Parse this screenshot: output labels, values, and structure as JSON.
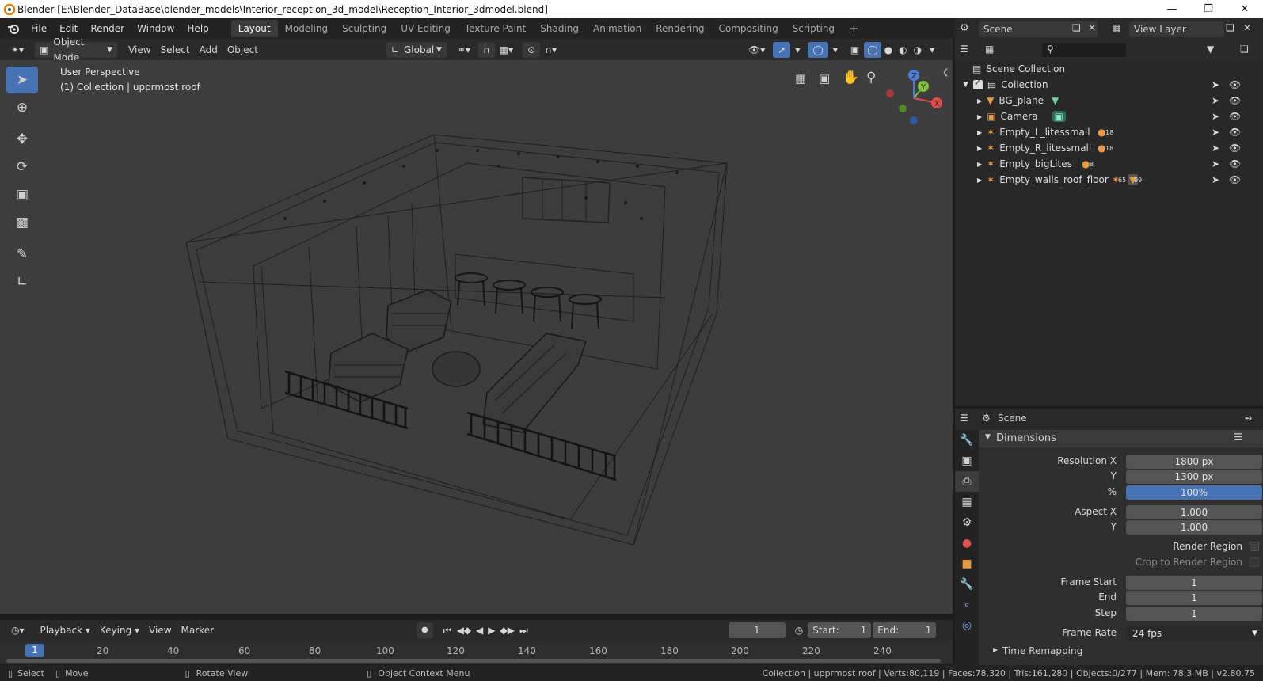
{
  "window": {
    "title": "Blender [E:\\Blender_DataBase\\blender_models\\Interior_reception_3d_model\\Reception_Interior_3dmodel.blend]"
  },
  "menus": [
    "File",
    "Edit",
    "Render",
    "Window",
    "Help"
  ],
  "workspaces": [
    "Layout",
    "Modeling",
    "Sculpting",
    "UV Editing",
    "Texture Paint",
    "Shading",
    "Animation",
    "Rendering",
    "Compositing",
    "Scripting"
  ],
  "active_workspace": "Layout",
  "scene": {
    "name": "Scene",
    "view_layer": "View Layer"
  },
  "viewport_header": {
    "mode": "Object Mode",
    "menu": [
      "View",
      "Select",
      "Add",
      "Object"
    ],
    "orientation": "Global"
  },
  "viewport": {
    "perspective": "User Perspective",
    "collection_info": "(1) Collection | upprmost roof",
    "axes": {
      "x": "X",
      "y": "Y",
      "z": "Z"
    }
  },
  "outliner": {
    "root": "Scene Collection",
    "collection": "Collection",
    "items": [
      {
        "name": "BG_plane",
        "badge": ""
      },
      {
        "name": "Camera",
        "badge": ""
      },
      {
        "name": "Empty_L_litessmall",
        "badge": "18"
      },
      {
        "name": "Empty_R_litessmall",
        "badge": "18"
      },
      {
        "name": "Empty_bigLites",
        "badge": "8"
      },
      {
        "name": "Empty_walls_roof_floor",
        "badge": "65",
        "badge2": "99"
      }
    ]
  },
  "properties": {
    "context": "Scene",
    "panel": "Dimensions",
    "resolution_x_label": "Resolution X",
    "resolution_x": "1800 px",
    "resolution_y_label": "Y",
    "resolution_y": "1300 px",
    "percent_label": "%",
    "percent": "100%",
    "aspect_x_label": "Aspect X",
    "aspect_x": "1.000",
    "aspect_y_label": "Y",
    "aspect_y": "1.000",
    "render_region": "Render Region",
    "crop_region": "Crop to Render Region",
    "frame_start_label": "Frame Start",
    "frame_start": "1",
    "frame_end_label": "End",
    "frame_end": "1",
    "frame_step_label": "Step",
    "frame_step": "1",
    "frame_rate_label": "Frame Rate",
    "frame_rate": "24 fps",
    "time_remapping": "Time Remapping"
  },
  "timeline": {
    "menus": [
      "Playback",
      "Keying",
      "View",
      "Marker"
    ],
    "current_frame": "1",
    "start_label": "Start:",
    "start": "1",
    "end_label": "End:",
    "end": "1",
    "ticks": [
      "1",
      "20",
      "40",
      "60",
      "80",
      "100",
      "120",
      "140",
      "160",
      "180",
      "200",
      "220",
      "240"
    ]
  },
  "statusbar": {
    "select": "Select",
    "move": "Move",
    "rotate": "Rotate View",
    "context": "Object Context Menu",
    "stats": "Collection | upprmost roof | Verts:80,119 | Faces:78,320 | Tris:161,280 | Objects:0/277 | Mem: 78.3 MB | v2.80.75"
  }
}
